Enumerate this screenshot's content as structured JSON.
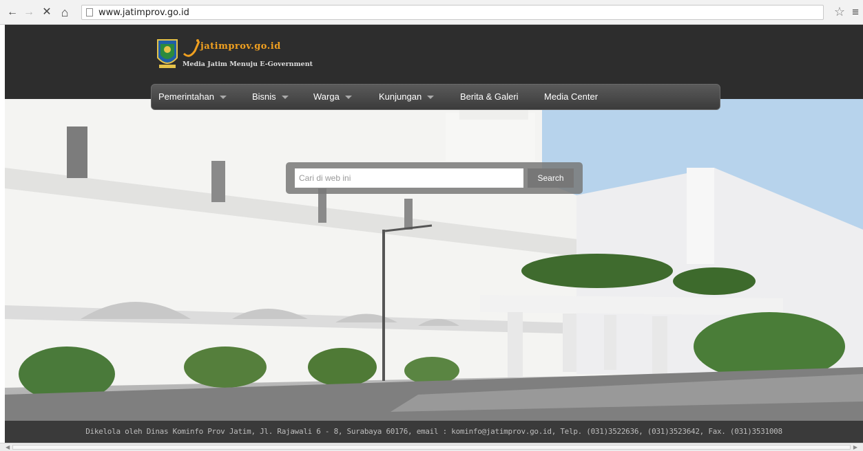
{
  "browser": {
    "url": "www.jatimprov.go.id",
    "back_icon": "←",
    "forward_icon": "→",
    "stop_icon": "✕",
    "home_icon": "⌂",
    "star_icon": "☆",
    "menu_icon": "≡"
  },
  "header": {
    "logo_text": "jatimprov.go.id",
    "logo_tagline": "Media Jatim Menuju E-Government"
  },
  "nav": {
    "items": [
      {
        "label": "Pemerintahan"
      },
      {
        "label": "Bisnis"
      },
      {
        "label": "Warga"
      },
      {
        "label": "Kunjungan"
      },
      {
        "label": "Berita & Galeri"
      },
      {
        "label": "Media Center"
      }
    ]
  },
  "search": {
    "placeholder": "Cari di web ini",
    "button_label": "Search"
  },
  "footer": {
    "text": "Dikelola oleh Dinas Kominfo Prov Jatim, Jl. Rajawali 6 - 8, Surabaya 60176, email : kominfo@jatimprov.go.id, Telp. (031)3522636, (031)3523642, Fax. (031)3531008"
  },
  "colors": {
    "header_bg": "#2d2d2d",
    "nav_bg": "#4a4a4a",
    "logo_accent": "#f0a020",
    "footer_bg": "#3a3a3a"
  }
}
